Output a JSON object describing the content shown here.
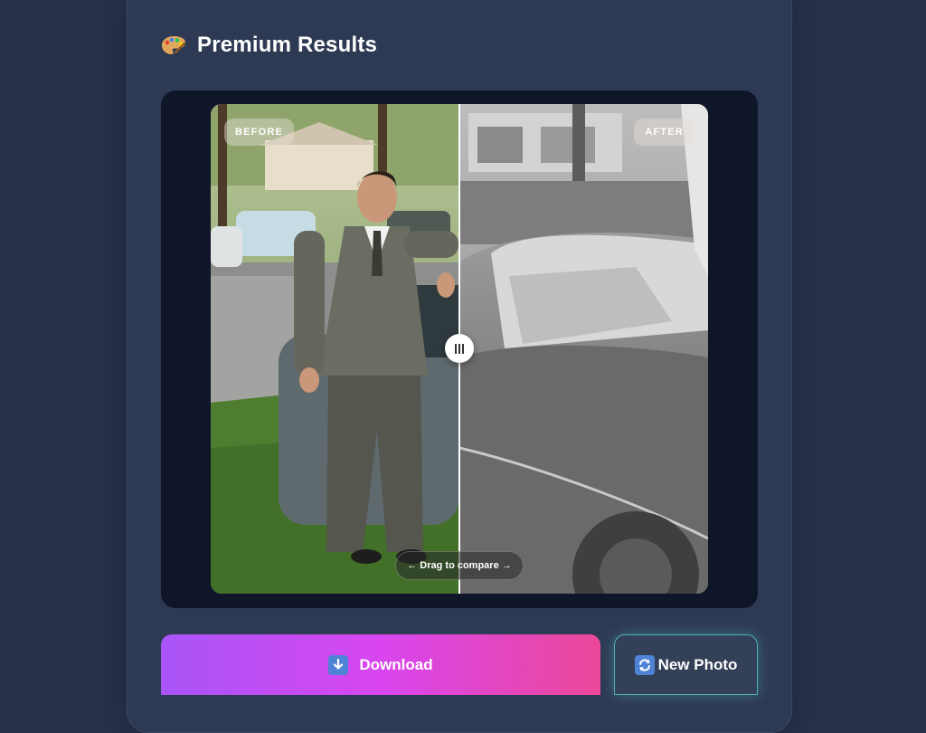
{
  "header": {
    "title": "Premium Results",
    "icon": "artist-palette-icon"
  },
  "comparison": {
    "before_label": "BEFORE",
    "after_label": "AFTER",
    "drag_hint": "← Drag to compare →",
    "slider_position": 0.5
  },
  "actions": {
    "download_label": "Download",
    "download_icon": "down-arrow-icon",
    "new_photo_label": "New Photo",
    "new_photo_icon": "refresh-icon"
  },
  "colors": {
    "background": "#28324b",
    "card": "#2e3a53",
    "download_gradient_start": "#a855f7",
    "download_gradient_end": "#ec4899",
    "new_photo_glow": "#4fb3b3"
  }
}
